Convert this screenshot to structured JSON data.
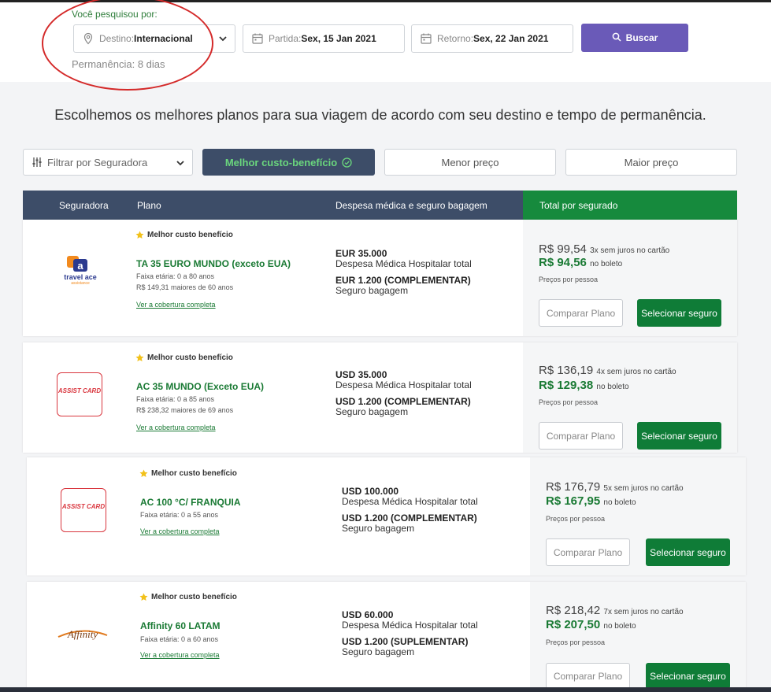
{
  "search": {
    "searched_label": "Você pesquisou por:",
    "destination_label": "Destino:",
    "destination_value": "Internacional",
    "departure_label": "Partida:",
    "departure_value": "Sex, 15 Jan 2021",
    "return_label": "Retorno:",
    "return_value": "Sex, 22 Jan 2021",
    "search_button": "Buscar",
    "stay": "Permanência: 8 dias"
  },
  "headline": "Escolhemos os melhores planos para sua viagem de acordo com seu destino e tempo de permanência.",
  "filters": {
    "insurer_filter": "Filtrar por Seguradora",
    "best": "Melhor custo-benefício",
    "lowest": "Menor preço",
    "highest": "Maior preço"
  },
  "table_header": {
    "insurer": "Seguradora",
    "plan": "Plano",
    "coverage": "Despesa médica e seguro bagagem",
    "total": "Total por segurado"
  },
  "plans": [
    {
      "logo": "travel ace",
      "logo_sub": "assistance",
      "badge": "Melhor custo benefício",
      "name": "TA 35 EURO MUNDO (exceto EUA)",
      "age1": "Faixa etária: 0 a 80 anos",
      "age2": "R$ 149,31 maiores de 60 anos",
      "coverage_link": "Ver a cobertura completa",
      "med_value": "EUR 35.000",
      "med_label": "Despesa Médica Hospitalar total",
      "bag_value": "EUR 1.200 (COMPLEMENTAR)",
      "bag_label": "Seguro bagagem",
      "price_card": "R$ 99,54",
      "installments": "3x sem juros no cartão",
      "price_boleto": "R$ 94,56",
      "boleto_label": "no boleto",
      "per_person": "Preços por pessoa",
      "compare": "Comparar Plano",
      "select": "Selecionar seguro"
    },
    {
      "logo": "ASSIST CARD",
      "badge": "Melhor custo benefício",
      "name": "AC 35 MUNDO (Exceto EUA)",
      "age1": "Faixa etária: 0 a 85 anos",
      "age2": "R$ 238,32 maiores de 69 anos",
      "coverage_link": "Ver a cobertura completa",
      "med_value": "USD 35.000",
      "med_label": "Despesa Médica Hospitalar total",
      "bag_value": "USD 1.200 (COMPLEMENTAR)",
      "bag_label": "Seguro bagagem",
      "price_card": "R$ 136,19",
      "installments": "4x sem juros no cartão",
      "price_boleto": "R$ 129,38",
      "boleto_label": "no boleto",
      "per_person": "Preços por pessoa",
      "compare": "Comparar Plano",
      "select": "Selecionar seguro"
    },
    {
      "logo": "ASSIST CARD",
      "badge": "Melhor custo benefício",
      "name": "AC 100 °C/ FRANQUIA",
      "age1": "Faixa etária: 0 a 55 anos",
      "coverage_link": "Ver a cobertura completa",
      "med_value": "USD 100.000",
      "med_label": "Despesa Médica Hospitalar total",
      "bag_value": "USD 1.200 (COMPLEMENTAR)",
      "bag_label": "Seguro bagagem",
      "price_card": "R$ 176,79",
      "installments": "5x sem juros no cartão",
      "price_boleto": "R$ 167,95",
      "boleto_label": "no boleto",
      "per_person": "Preços por pessoa",
      "compare": "Comparar Plano",
      "select": "Selecionar seguro"
    },
    {
      "logo": "Affinity",
      "badge": "Melhor custo benefício",
      "name": "Affinity 60 LATAM",
      "age1": "Faixa etária: 0 a 60 anos",
      "coverage_link": "Ver a cobertura completa",
      "med_value": "USD 60.000",
      "med_label": "Despesa Médica Hospitalar total",
      "bag_value": "USD 1.200 (SUPLEMENTAR)",
      "bag_label": "Seguro bagagem",
      "price_card": "R$ 218,42",
      "installments": "7x sem juros no cartão",
      "price_boleto": "R$ 207,50",
      "boleto_label": "no boleto",
      "per_person": "Preços por pessoa",
      "compare": "Comparar Plano",
      "select": "Selecionar seguro"
    }
  ],
  "colors": {
    "accent_purple": "#6a5ab8",
    "header_navy": "#3d4d68",
    "green": "#168a3d",
    "annotation_red": "#d42a2a"
  }
}
